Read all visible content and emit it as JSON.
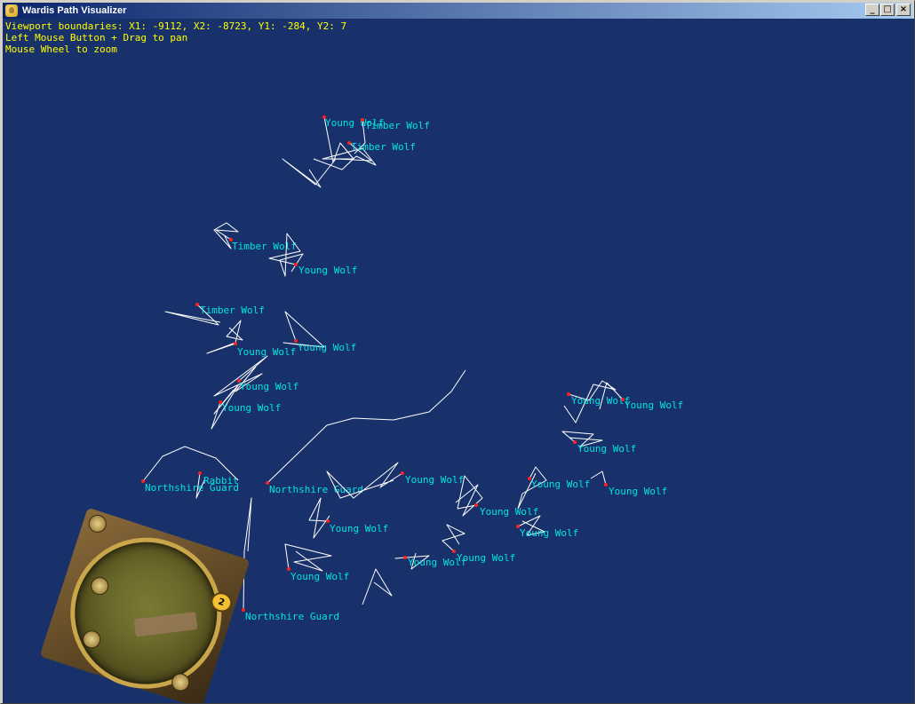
{
  "window": {
    "title": "Wardis Path Visualizer",
    "buttons": {
      "minimize": "_",
      "maximize": "□",
      "close": "×"
    }
  },
  "info": {
    "line1": "Viewport boundaries: X1: -9112, X2: -8723, Y1: -284, Y2: 7",
    "line2": "Left Mouse Button + Drag to pan",
    "line3": "Mouse Wheel to zoom"
  },
  "colors": {
    "background": "#19316a",
    "info_text": "#ffff00",
    "path_line": "#ffffff",
    "npc_label": "#00e5e5",
    "npc_dot": "#ff2020"
  },
  "npcs": [
    {
      "name": "Young Wolf"
    },
    {
      "name": "Timber Wolf"
    },
    {
      "name": "Timber Wolf"
    },
    {
      "name": "Timber Wolf"
    },
    {
      "name": "Young Wolf"
    },
    {
      "name": "Timber Wolf"
    },
    {
      "name": "Young Wolf"
    },
    {
      "name": "Young Wolf"
    },
    {
      "name": "Young Wolf"
    },
    {
      "name": "Young Wolf"
    },
    {
      "name": "Rabbit"
    },
    {
      "name": "Northshire Guard"
    },
    {
      "name": "Northshire Guard"
    },
    {
      "name": "Young Wolf"
    },
    {
      "name": "Young Wolf"
    },
    {
      "name": "Young Wolf"
    },
    {
      "name": "Young Wolf"
    },
    {
      "name": "Young Wolf"
    },
    {
      "name": "Young Wolf"
    },
    {
      "name": "Young Wolf"
    },
    {
      "name": "Young Wolf"
    },
    {
      "name": "Young Wolf"
    },
    {
      "name": "Young Wolf"
    },
    {
      "name": "Young Wolf"
    },
    {
      "name": "Young Wolf"
    },
    {
      "name": "Northshire Guard"
    }
  ],
  "minimap": {
    "zoom_badge": "2"
  }
}
